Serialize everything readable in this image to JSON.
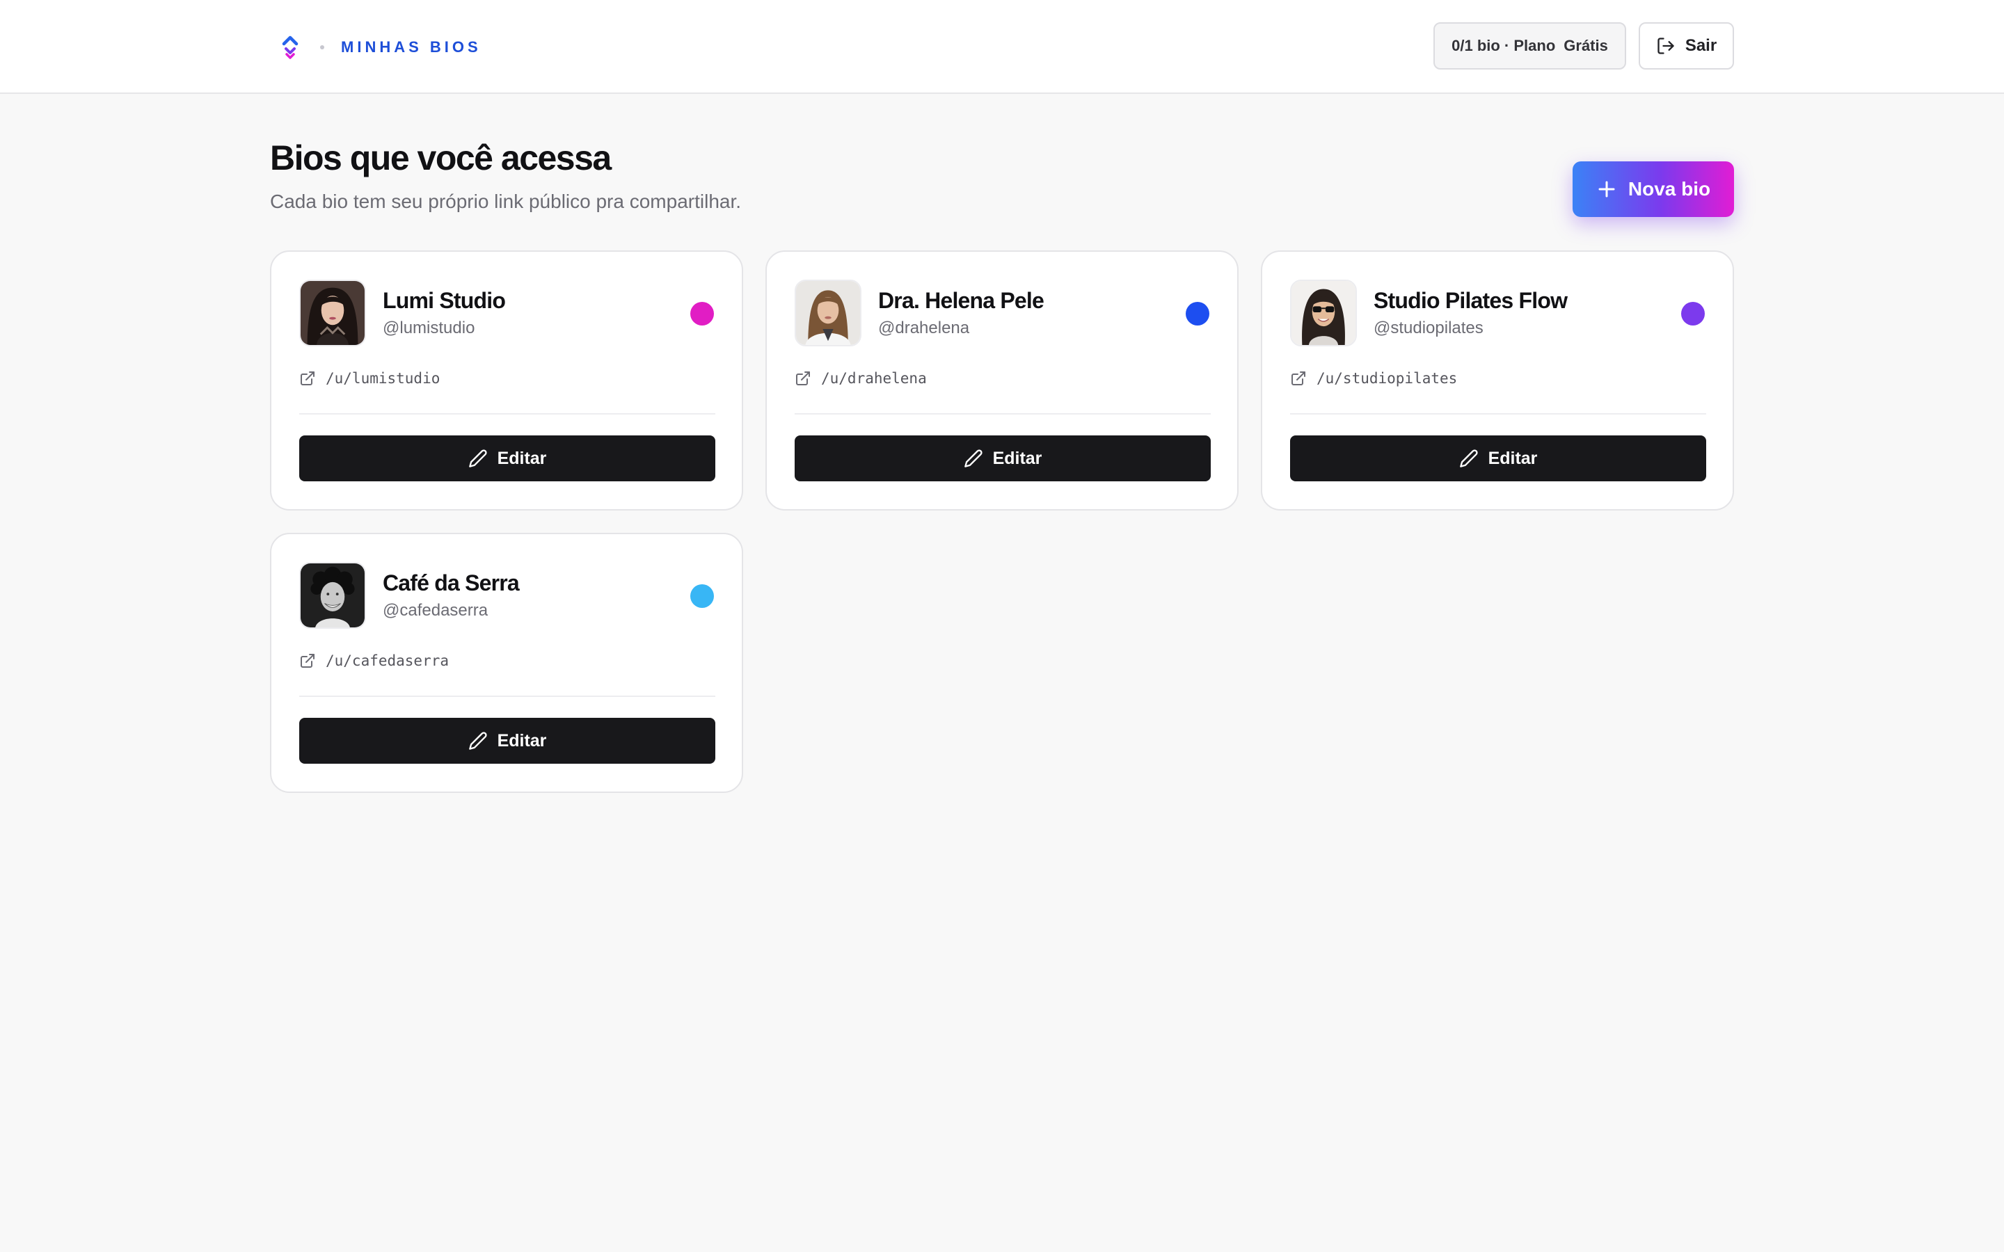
{
  "header": {
    "brand_title": "MINHAS BIOS",
    "plan_usage": "0/1 bio · Plano",
    "plan_name": "Grátis",
    "logout_label": "Sair"
  },
  "main": {
    "title": "Bios que você acessa",
    "subtitle": "Cada bio tem seu próprio link público pra compartilhar.",
    "new_bio_label": "Nova bio"
  },
  "colors": {
    "brand": "#1d4ed8",
    "button_dark": "#18181b",
    "gradient_start": "#3b82f6",
    "gradient_end": "#e11dd4"
  },
  "bios": [
    {
      "name": "Lumi Studio",
      "handle": "@lumistudio",
      "link": "/u/lumistudio",
      "color": "#e11dc4",
      "edit_label": "Editar",
      "avatar": "portrait-woman-dark-hair"
    },
    {
      "name": "Dra. Helena Pele",
      "handle": "@drahelena",
      "link": "/u/drahelena",
      "color": "#1d4ef0",
      "edit_label": "Editar",
      "avatar": "portrait-woman-doctor"
    },
    {
      "name": "Studio Pilates Flow",
      "handle": "@studiopilates",
      "link": "/u/studiopilates",
      "color": "#7c3aed",
      "edit_label": "Editar",
      "avatar": "portrait-woman-sunglasses"
    },
    {
      "name": "Café da Serra",
      "handle": "@cafedaserra",
      "link": "/u/cafedaserra",
      "color": "#38b6f5",
      "edit_label": "Editar",
      "avatar": "portrait-man-curly-bw"
    }
  ]
}
